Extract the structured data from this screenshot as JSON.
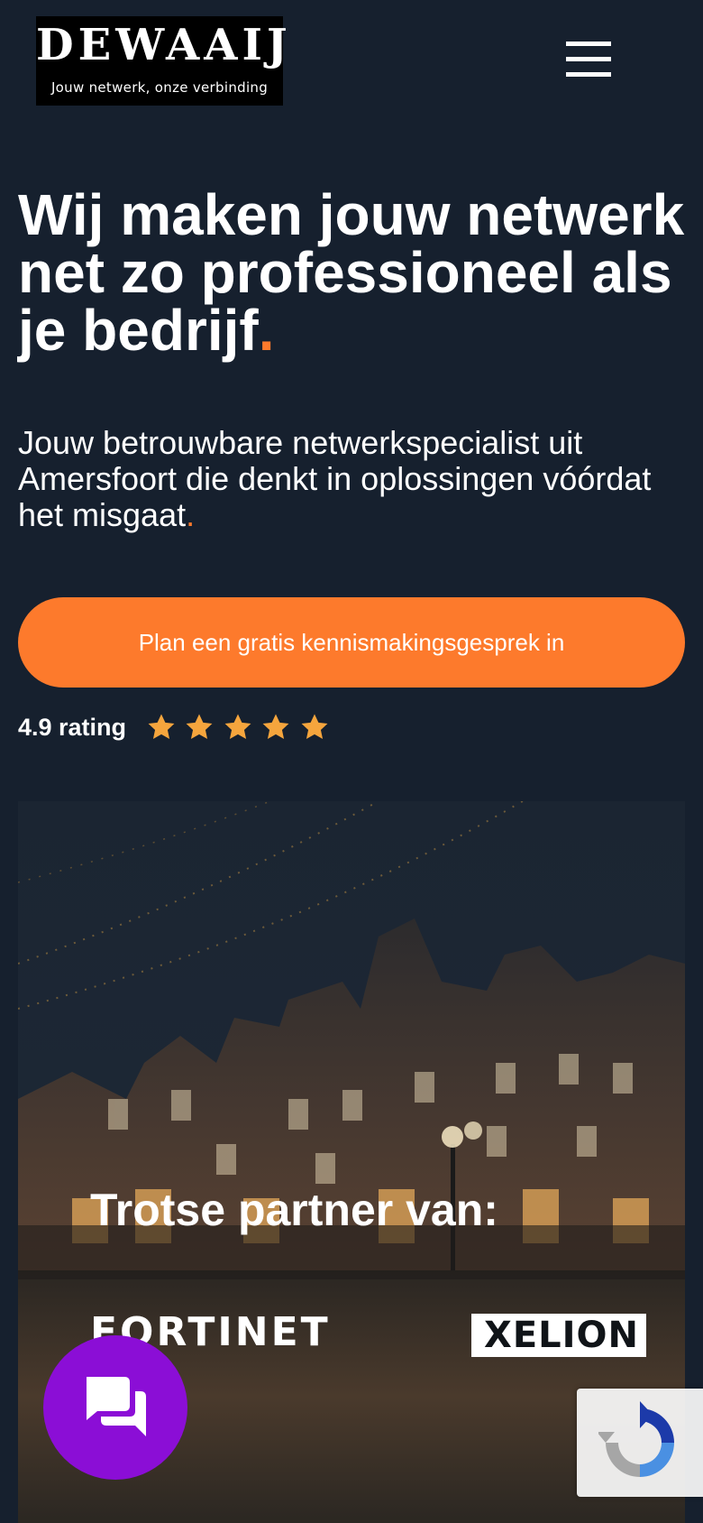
{
  "header": {
    "logo_word": "DEWAAIJ",
    "logo_tagline": "Jouw netwerk, onze verbinding",
    "menu_icon": "hamburger-menu-icon"
  },
  "hero": {
    "title": "Wij maken jouw netwerk net zo professioneel als je bedrijf",
    "title_end": ".",
    "subtitle": "Jouw betrouwbare netwerkspecialist uit Amersfoort die denkt in oplossingen vóórdat het misgaat",
    "subtitle_end": ".",
    "cta_label": "Plan een gratis kennismakingsgesprek in",
    "rating_label": "4.9 rating",
    "rating_stars": 5
  },
  "partners": {
    "heading": "Trotse partner van:",
    "logos": [
      "FORTINET",
      "XELION"
    ]
  },
  "widgets": {
    "chat_icon": "chat-bubbles-icon",
    "recaptcha_icon": "recaptcha-icon"
  },
  "colors": {
    "background": "#16202e",
    "accent": "#fd7a2c",
    "chat": "#8b0ed6",
    "star": "#f5a53d"
  }
}
